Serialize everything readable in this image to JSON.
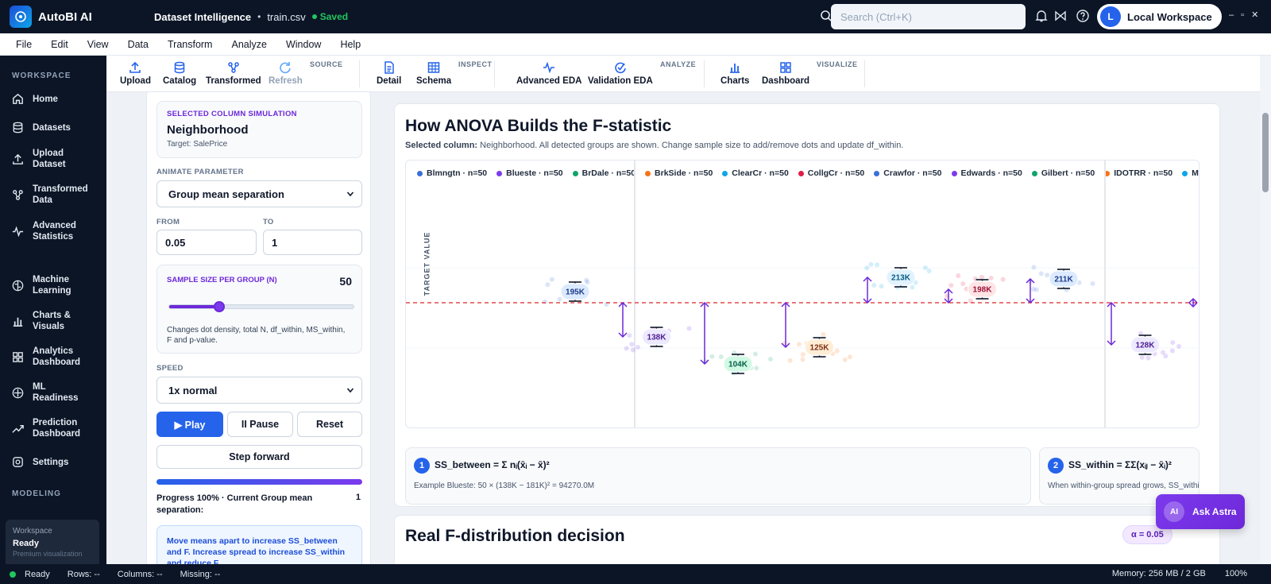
{
  "app": {
    "name": "AutoBI AI",
    "doc_title": "Dataset Intelligence",
    "file": "train.csv",
    "status": "Saved"
  },
  "search": {
    "placeholder": "Search (Ctrl+K)"
  },
  "user": {
    "initial": "L",
    "workspace": "Local Workspace"
  },
  "window_controls": "– ▫ ✕",
  "menu": [
    "File",
    "Edit",
    "View",
    "Data",
    "Transform",
    "Analyze",
    "Window",
    "Help"
  ],
  "sidebar": {
    "section_workspace": "WORKSPACE",
    "section_modeling": "MODELING",
    "items": [
      {
        "label": "Home",
        "icon": "home-icon"
      },
      {
        "label": "Datasets",
        "icon": "database-icon"
      },
      {
        "label": "Upload Dataset",
        "icon": "upload-icon"
      },
      {
        "label": "Transformed Data",
        "icon": "transform-icon"
      },
      {
        "label": "Advanced Statistics",
        "icon": "pulse-icon"
      },
      {
        "label": "Machine Learning",
        "icon": "brain-icon"
      },
      {
        "label": "Charts & Visuals",
        "icon": "bar-chart-icon"
      },
      {
        "label": "Analytics Dashboard",
        "icon": "dashboard-icon"
      },
      {
        "label": "ML Readiness",
        "icon": "ml-icon"
      },
      {
        "label": "Prediction Dashboard",
        "icon": "trend-icon"
      },
      {
        "label": "Settings",
        "icon": "gear-icon"
      }
    ],
    "status": {
      "label": "Workspace",
      "value": "Ready",
      "sub": "Premium visualization"
    }
  },
  "toolbar": {
    "groups": {
      "source": "SOURCE",
      "inspect": "INSPECT",
      "analyze": "ANALYZE",
      "visualize": "VISUALIZE"
    },
    "tools": {
      "upload": "Upload",
      "catalog": "Catalog",
      "transformed": "Transformed",
      "refresh": "Refresh",
      "detail": "Detail",
      "schema": "Schema",
      "advanced_eda": "Advanced EDA",
      "validation_eda": "Validation EDA",
      "charts": "Charts",
      "dashboard": "Dashboard"
    }
  },
  "controls": {
    "sim_title": "SELECTED COLUMN SIMULATION",
    "column": "Neighborhood",
    "target": "Target: SalePrice",
    "animate_label": "ANIMATE PARAMETER",
    "animate_value": "Group mean separation",
    "from_label": "FROM",
    "from_value": "0.05",
    "to_label": "TO",
    "to_value": "1",
    "sample_label": "SAMPLE SIZE PER GROUP (N)",
    "sample_value": "50",
    "sample_fraction": 0.27,
    "sample_help": "Changes dot density, total N, df_within, MS_within, F and p-value.",
    "speed_label": "SPEED",
    "speed_value": "1x normal",
    "play": "▶ Play",
    "pause": "II Pause",
    "reset": "Reset",
    "step": "Step forward",
    "progress_text": "Progress 100% · Current Group mean separation:",
    "progress_step": "1",
    "hint": "Move means apart to increase SS_between and F. Increase spread to increase SS_within and reduce F."
  },
  "anova": {
    "title": "How ANOVA Builds the F-statistic",
    "subtitle_bold": "Selected column:",
    "subtitle_rest": " Neighborhood. All detected groups are shown. Change sample size to add/remove dots and update df_within."
  },
  "chart_data": {
    "type": "scatter",
    "ylabel": "TARGET VALUE",
    "grand_mean": 181,
    "unit": "K",
    "legend": [
      {
        "name": "Blmngtn · n=50",
        "color": "#3b6fd8"
      },
      {
        "name": "Blueste · n=50",
        "color": "#7c3aed"
      },
      {
        "name": "BrDale · n=50",
        "color": "#10a36b"
      },
      {
        "name": "BrkSide · n=50",
        "color": "#f97316"
      },
      {
        "name": "ClearCr · n=50",
        "color": "#0ea5e9"
      },
      {
        "name": "CollgCr · n=50",
        "color": "#e11d48"
      },
      {
        "name": "Crawfor · n=50",
        "color": "#3b6fd8"
      },
      {
        "name": "Edwards · n=50",
        "color": "#7c3aed"
      },
      {
        "name": "Gilbert · n=50",
        "color": "#10a36b"
      },
      {
        "name": "IDOTRR · n=50",
        "color": "#f97316"
      },
      {
        "name": "M",
        "color": "#0ea5e9"
      }
    ],
    "groups": [
      {
        "name": "Blmngtn",
        "n": "n=50",
        "mean": 195,
        "label": "195K",
        "color": "#3b6fd8",
        "badge_bg": "#dbeafe",
        "badge_fg": "#1e3a8a"
      },
      {
        "name": "Blueste",
        "n": "n=50",
        "mean": 138,
        "label": "138K",
        "color": "#7c3aed",
        "badge_bg": "#ede9fe",
        "badge_fg": "#4c1d95"
      },
      {
        "name": "BrDale",
        "n": "n=50",
        "mean": 104,
        "label": "104K",
        "color": "#10a36b",
        "badge_bg": "#d1fae5",
        "badge_fg": "#065f46"
      },
      {
        "name": "BrkSide",
        "n": "n=50",
        "mean": 125,
        "label": "125K",
        "color": "#f97316",
        "badge_bg": "#ffedd5",
        "badge_fg": "#7c2d12"
      },
      {
        "name": "ClearCr",
        "n": "n=50",
        "mean": 213,
        "label": "213K",
        "color": "#0ea5e9",
        "badge_bg": "#e0f2fe",
        "badge_fg": "#075985"
      },
      {
        "name": "CollgCr",
        "n": "n=50",
        "mean": 198,
        "label": "198K",
        "color": "#e11d48",
        "badge_bg": "#ffe4e6",
        "badge_fg": "#9f1239"
      },
      {
        "name": "Crawfor",
        "n": "n=50",
        "mean": 211,
        "label": "211K",
        "color": "#3b6fd8",
        "badge_bg": "#dbeafe",
        "badge_fg": "#1e3a8a"
      },
      {
        "name": "Edwards",
        "n": "n=50",
        "mean": 128,
        "label": "128K",
        "color": "#7c3aed",
        "badge_bg": "#ede9fe",
        "badge_fg": "#4c1d95"
      }
    ]
  },
  "ss_between": {
    "num": "1",
    "formula": "SS_between = Σ nᵢ(x̄ᵢ − x̄)²",
    "example": "Example Blueste: 50 × (138K − 181K)² = 94270.0M"
  },
  "ss_within": {
    "num": "2",
    "formula": "SS_within = ΣΣ(xᵢⱼ − x̄ᵢ)²",
    "example": "When within-group spread grows, SS_within increases"
  },
  "fdist": {
    "title": "Real F-distribution decision",
    "alpha": "α = 0.05"
  },
  "astra": {
    "badge": "AI",
    "label": "Ask Astra"
  },
  "statusbar": {
    "ready": "Ready",
    "rows": "Rows: --",
    "columns": "Columns: --",
    "missing": "Missing: --",
    "memory": "Memory: 256 MB / 2 GB",
    "zoom": "100%"
  }
}
